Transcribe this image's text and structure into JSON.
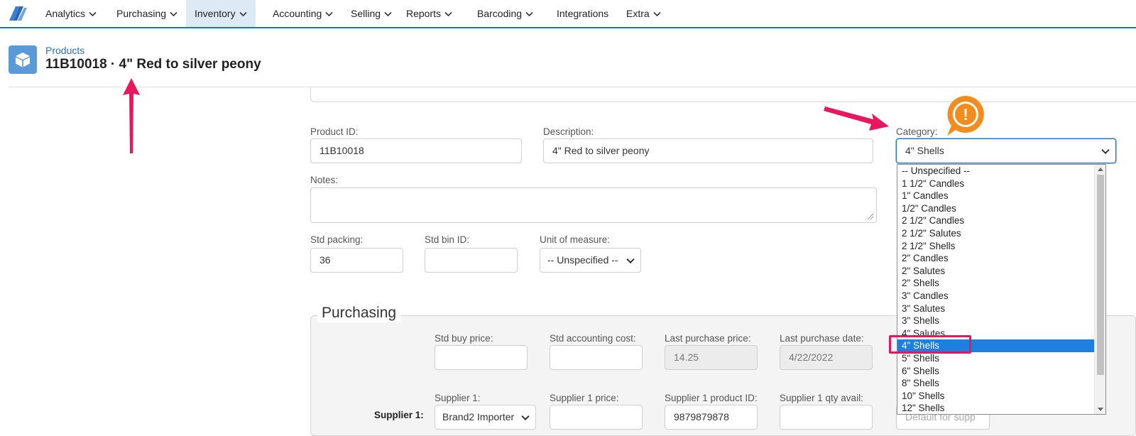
{
  "nav": {
    "items": [
      {
        "label": "Analytics",
        "has_menu": true
      },
      {
        "label": "Purchasing",
        "has_menu": true
      },
      {
        "label": "Inventory",
        "has_menu": true,
        "active": true
      },
      {
        "label": "Accounting",
        "has_menu": true
      },
      {
        "label": "Selling",
        "has_menu": true
      },
      {
        "label": "Reports",
        "has_menu": true
      },
      {
        "label": "Barcoding",
        "has_menu": true
      },
      {
        "label": "Integrations",
        "has_menu": false
      },
      {
        "label": "Extra",
        "has_menu": true
      }
    ],
    "accent": "#1a73c9"
  },
  "header": {
    "breadcrumb": "Products",
    "title": "11B10018 · 4\" Red to silver peony",
    "icon": "box-icon"
  },
  "form": {
    "product_id": {
      "label": "Product ID:",
      "value": "11B10018"
    },
    "description": {
      "label": "Description:",
      "value": "4\" Red to silver peony"
    },
    "category": {
      "label": "Category:",
      "value": "4\" Shells"
    },
    "notes": {
      "label": "Notes:",
      "value": ""
    },
    "std_packing": {
      "label": "Std packing:",
      "value": "36"
    },
    "std_bin_id": {
      "label": "Std bin ID:",
      "value": ""
    },
    "unit_of_measure": {
      "label": "Unit of measure:",
      "value": "-- Unspecified --"
    }
  },
  "purchasing": {
    "title": "Purchasing",
    "std_buy_price": {
      "label": "Std buy price:",
      "value": ""
    },
    "std_accounting_cost": {
      "label": "Std accounting cost:",
      "value": ""
    },
    "last_purchase_price": {
      "label": "Last purchase price:",
      "value": "14.25"
    },
    "last_purchase_date": {
      "label": "Last purchase date:",
      "value": "4/22/2022"
    },
    "supplier1_row_label": "Supplier 1:",
    "supplier1": {
      "label": "Supplier 1:",
      "value": "Brand2 Importer"
    },
    "supplier1_price": {
      "label": "Supplier 1 price:",
      "value": ""
    },
    "supplier1_product_id": {
      "label": "Supplier 1 product ID:",
      "value": "9879879878"
    },
    "supplier1_qty_avail": {
      "label": "Supplier 1 qty avail:",
      "value": ""
    },
    "supplier1_extra_placeholder": "Default for supp"
  },
  "category_dropdown": {
    "options": [
      "-- Unspecified --",
      "1 1/2\" Candles",
      "1\" Candles",
      "1/2\" Candles",
      "2 1/2\" Candles",
      "2 1/2\" Salutes",
      "2 1/2\" Shells",
      "2\" Candles",
      "2\" Salutes",
      "2\" Shells",
      "3\" Candles",
      "3\" Salutes",
      "3\" Shells",
      "4\" Salutes",
      "4\" Shells",
      "5\" Shells",
      "6\" Shells",
      "8\" Shells",
      "10\" Shells",
      "12\" Shells"
    ],
    "selected_index": 14,
    "selected_color": "#1e7fe0"
  },
  "annotations": {
    "arrow_color": "#e8175d",
    "badge_color": "#f28c1e",
    "badge_glyph": "!"
  }
}
